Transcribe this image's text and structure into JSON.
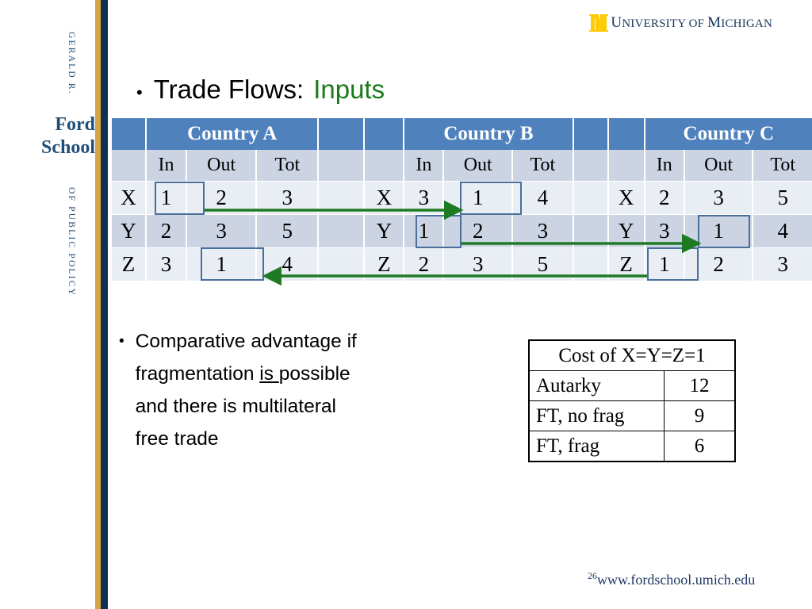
{
  "branding": {
    "rail_top_text": "GERALD R.",
    "rail_name_1": "Ford",
    "rail_name_2": "School",
    "rail_bottom_text": "OF PUBLIC POLICY",
    "navy": "#1f4e79",
    "gold": "#d4a642",
    "rail_navy_stripe": "#10314f"
  },
  "university_logo": {
    "block_letter": "M",
    "wordmark_lead": "U",
    "wordmark_rest_1": "NIVERSITY",
    "wordmark_of": " OF ",
    "wordmark_lead_2": "M",
    "wordmark_rest_2": "ICHIGAN",
    "maize": "#ffcb05",
    "blue": "#16365c"
  },
  "title": {
    "bullet": "•",
    "main": "Trade Flows:",
    "accent": "Inputs",
    "accent_color": "#1a7a1a"
  },
  "trade_table": {
    "country_headers": [
      "Country A",
      "Country B",
      "Country C"
    ],
    "sub_headers": [
      "In",
      "Out",
      "Tot"
    ],
    "row_labels": [
      "X",
      "Y",
      "Z"
    ],
    "header_bg": "#4f81bd",
    "subheader_bg": "#ccd4e4",
    "row_bg_odd": "#e9edf4",
    "row_bg_even": "#ccd4e4",
    "highlight_border": "#4a6f9b",
    "arrow_color": "#1e7b24",
    "countries": [
      {
        "name": "Country A",
        "rows": [
          {
            "label": "X",
            "in": "1",
            "out": "2",
            "tot": "3"
          },
          {
            "label": "Y",
            "in": "2",
            "out": "3",
            "tot": "5"
          },
          {
            "label": "Z",
            "in": "3",
            "out": "1",
            "tot": "4"
          }
        ]
      },
      {
        "name": "Country B",
        "rows": [
          {
            "label": "X",
            "in": "3",
            "out": "1",
            "tot": "4"
          },
          {
            "label": "Y",
            "in": "1",
            "out": "2",
            "tot": "3"
          },
          {
            "label": "Z",
            "in": "2",
            "out": "3",
            "tot": "5"
          }
        ]
      },
      {
        "name": "Country C",
        "rows": [
          {
            "label": "X",
            "in": "2",
            "out": "3",
            "tot": "5"
          },
          {
            "label": "Y",
            "in": "3",
            "out": "1",
            "tot": "4"
          },
          {
            "label": "Z",
            "in": "1",
            "out": "2",
            "tot": "3"
          }
        ]
      }
    ],
    "highlighted_cells": [
      {
        "country": "Country A",
        "row": "X",
        "column": "In",
        "value": "1"
      },
      {
        "country": "Country A",
        "row": "Z",
        "column": "Out",
        "value": "1"
      },
      {
        "country": "Country B",
        "row": "X",
        "column": "Out",
        "value": "1"
      },
      {
        "country": "Country B",
        "row": "Y",
        "column": "In",
        "value": "1"
      },
      {
        "country": "Country C",
        "row": "Y",
        "column": "Out",
        "value": "1"
      },
      {
        "country": "Country C",
        "row": "Z",
        "column": "In",
        "value": "1"
      }
    ],
    "flow_arrows": [
      {
        "from": "Country A X In",
        "to": "Country B X Out",
        "direction": "right"
      },
      {
        "from": "Country B Y In",
        "to": "Country C Y Out",
        "direction": "right"
      },
      {
        "from": "Country C Z In",
        "to": "Country A Z Out",
        "direction": "left"
      }
    ]
  },
  "bullet": {
    "dot": "•",
    "line1": "Comparative advantage if",
    "line2_pre": "fragmentation ",
    "line2_underline": "is ",
    "line2_post": "possible",
    "line3": "and there is multilateral",
    "line4": "free trade"
  },
  "cost_table": {
    "header": "Cost of X=Y=Z=1",
    "rows": [
      {
        "label": "Autarky",
        "value": "12"
      },
      {
        "label": "FT, no frag",
        "value": "9"
      },
      {
        "label": "FT, frag",
        "value": "6"
      }
    ]
  },
  "footer": {
    "page_number": "26",
    "url": "www.fordschool.umich.edu"
  }
}
